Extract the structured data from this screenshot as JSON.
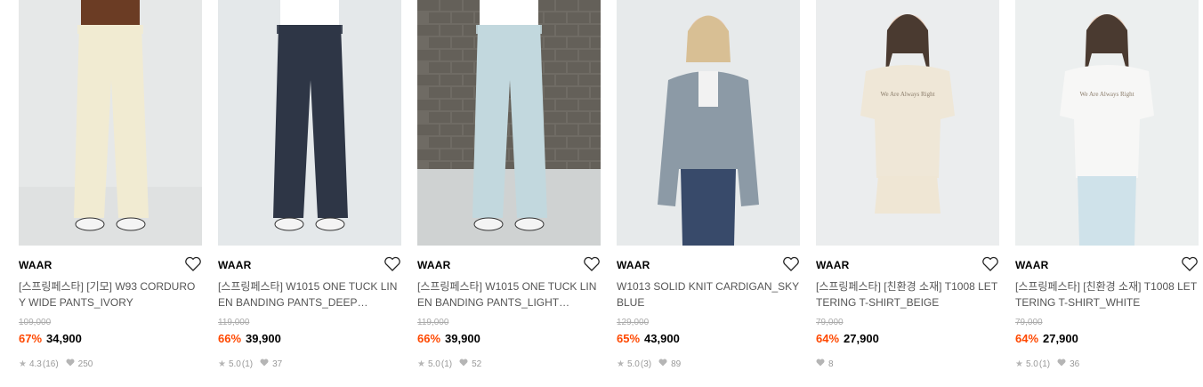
{
  "products": [
    {
      "brand": "WAAR",
      "name": "[스프링페스타] [기모] W93 CORDUROY WIDE PANTS_IVORY",
      "original_price": "109,000",
      "discount": "67%",
      "price": "34,900",
      "rating": "4.3",
      "review_count": "(16)",
      "likes": "250",
      "image_icon": "pants-ivory-image",
      "colors": {
        "garment": "#f1ebd2",
        "bg": "#e6e8e8",
        "top": "#6b3c24"
      }
    },
    {
      "brand": "WAAR",
      "name": "[스프링페스타] W1015 ONE TUCK LINEN BANDING PANTS_DEEP…",
      "original_price": "119,000",
      "discount": "66%",
      "price": "39,900",
      "rating": "5.0",
      "review_count": "(1)",
      "likes": "37",
      "image_icon": "pants-deep-navy-image",
      "colors": {
        "garment": "#2e3646",
        "bg": "#e4e8ea",
        "top": "#ffffff"
      }
    },
    {
      "brand": "WAAR",
      "name": "[스프링페스타] W1015 ONE TUCK LINEN BANDING PANTS_LIGHT…",
      "original_price": "119,000",
      "discount": "66%",
      "price": "39,900",
      "rating": "5.0",
      "review_count": "(1)",
      "likes": "52",
      "image_icon": "pants-light-blue-image",
      "colors": {
        "garment": "#c2d8de",
        "bg": "#d9dcdd",
        "top": "#ffffff"
      }
    },
    {
      "brand": "WAAR",
      "name": "W1013 SOLID KNIT CARDIGAN_SKY BLUE",
      "original_price": "129,000",
      "discount": "65%",
      "price": "43,900",
      "rating": "5.0",
      "review_count": "(3)",
      "likes": "89",
      "image_icon": "cardigan-sky-blue-image",
      "colors": {
        "garment": "#8c9aa6",
        "bg": "#e7eaeb",
        "top": "#384a6a"
      }
    },
    {
      "brand": "WAAR",
      "name": "[스프링페스타] [친환경 소재] T1008 LETTERING T-SHIRT_BEIGE",
      "original_price": "79,000",
      "discount": "64%",
      "price": "27,900",
      "rating": "",
      "review_count": "",
      "likes": "8",
      "image_icon": "tshirt-beige-image",
      "colors": {
        "garment": "#efe7d7",
        "bg": "#ebedee",
        "top": "#efe6d4"
      }
    },
    {
      "brand": "WAAR",
      "name": "[스프링페스타] [친환경 소재] T1008 LETTERING T-SHIRT_WHITE",
      "original_price": "79,000",
      "discount": "64%",
      "price": "27,900",
      "rating": "5.0",
      "review_count": "(1)",
      "likes": "36",
      "image_icon": "tshirt-white-image",
      "colors": {
        "garment": "#f7f7f6",
        "bg": "#ecefef",
        "top": "#cfe2ea"
      }
    }
  ],
  "icons": {
    "wishlist": "heart-outline-icon",
    "rating": "star-icon",
    "likes": "heart-filled-icon"
  }
}
